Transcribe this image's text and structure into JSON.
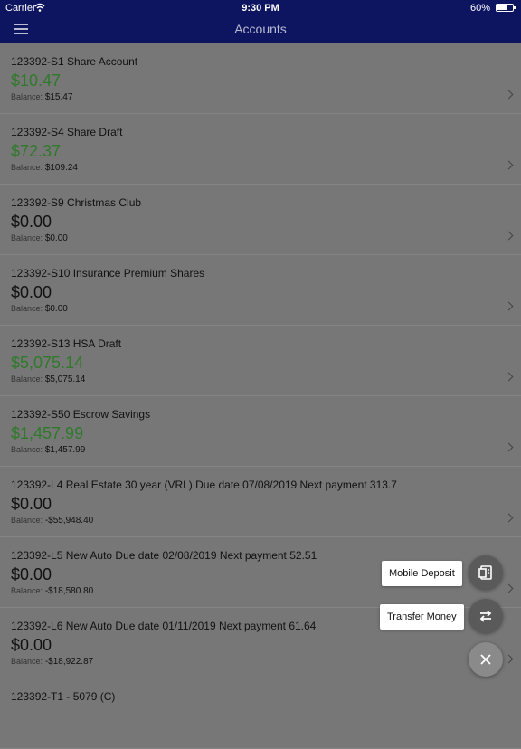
{
  "status": {
    "carrier": "Carrier",
    "time": "9:30 PM",
    "battery": "60%"
  },
  "nav": {
    "title": "Accounts"
  },
  "accounts": [
    {
      "name": "123392-S1 Share Account",
      "amount": "$10.47",
      "balance_label": "Balance:",
      "balance": "$15.47"
    },
    {
      "name": "123392-S4 Share Draft",
      "amount": "$72.37",
      "balance_label": "Balance:",
      "balance": "$109.24"
    },
    {
      "name": "123392-S9 Christmas Club",
      "amount": "$0.00",
      "balance_label": "Balance:",
      "balance": "$0.00"
    },
    {
      "name": "123392-S10 Insurance Premium Shares",
      "amount": "$0.00",
      "balance_label": "Balance:",
      "balance": "$0.00"
    },
    {
      "name": "123392-S13 HSA Draft",
      "amount": "$5,075.14",
      "balance_label": "Balance:",
      "balance": "$5,075.14"
    },
    {
      "name": "123392-S50 Escrow Savings",
      "amount": "$1,457.99",
      "balance_label": "Balance:",
      "balance": "$1,457.99"
    },
    {
      "name": "123392-L4 Real Estate 30 year (VRL) Due date 07/08/2019 Next payment 313.7",
      "amount": "$0.00",
      "balance_label": "Balance:",
      "balance": "-$55,948.40"
    },
    {
      "name": "123392-L5 New Auto Due date 02/08/2019 Next payment 52.51",
      "amount": "$0.00",
      "balance_label": "Balance:",
      "balance": "-$18,580.80"
    },
    {
      "name": "123392-L6 New Auto Due date 01/11/2019 Next payment 61.64",
      "amount": "$0.00",
      "balance_label": "Balance:",
      "balance": "-$18,922.87"
    },
    {
      "name": "123392-T1 - 5079 (C)",
      "amount": "",
      "balance_label": "",
      "balance": ""
    }
  ],
  "fab": {
    "mobile_deposit": "Mobile Deposit",
    "transfer_money": "Transfer Money"
  },
  "colors": {
    "nav": "#0d1460",
    "positive": "#2f7a2a",
    "overlay": "#777777"
  }
}
